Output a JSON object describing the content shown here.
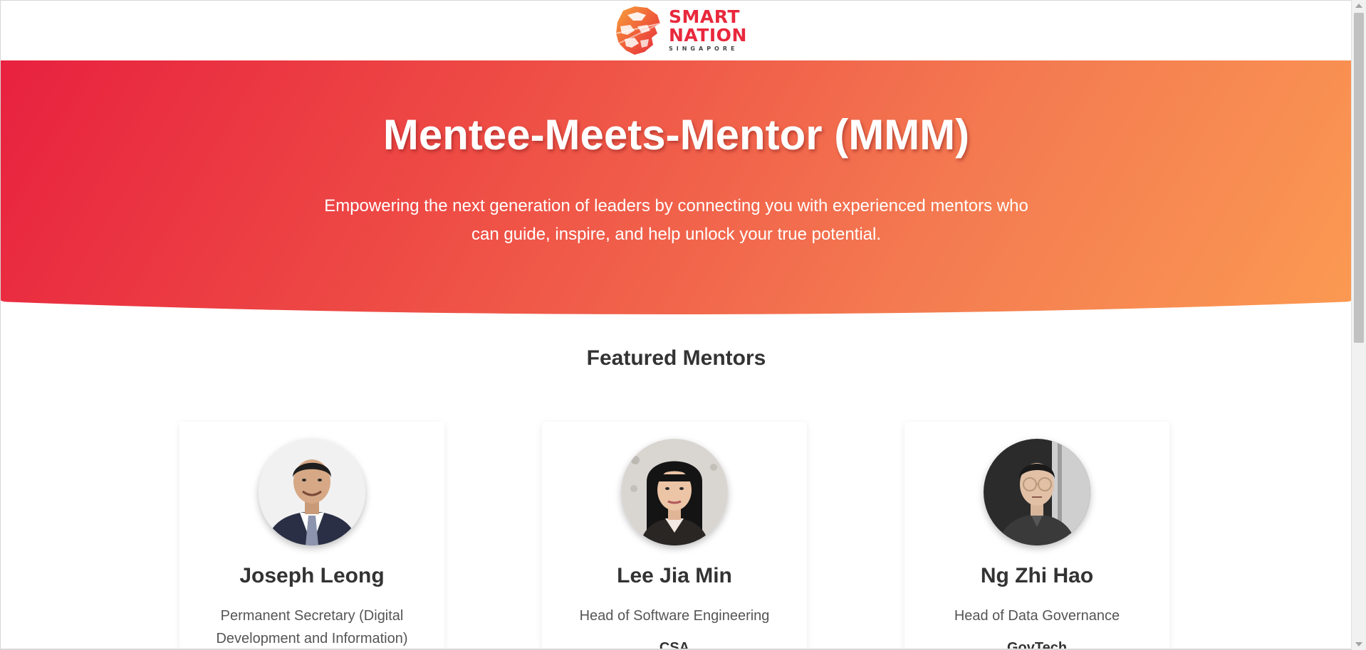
{
  "header": {
    "logo": {
      "line1": "SMART",
      "line2": "NATION",
      "line3": "SINGAPORE",
      "icon": "lion-head-logo-icon"
    }
  },
  "hero": {
    "title": "Mentee-Meets-Mentor (MMM)",
    "subtitle": "Empowering the next generation of leaders by connecting you with experienced mentors who can guide, inspire, and help unlock your true potential."
  },
  "featured": {
    "title": "Featured Mentors",
    "mentors": [
      {
        "name": "Joseph Leong",
        "role": "Permanent Secretary (Digital Development and Information)",
        "org": ""
      },
      {
        "name": "Lee Jia Min",
        "role": "Head of Software Engineering",
        "org": "CSA"
      },
      {
        "name": "Ng Zhi Hao",
        "role": "Head of Data Governance",
        "org": "GovTech"
      }
    ]
  },
  "colors": {
    "brand_red": "#e9283c",
    "hero_gradient_start": "#e8213f",
    "hero_gradient_end": "#fb9a52"
  }
}
